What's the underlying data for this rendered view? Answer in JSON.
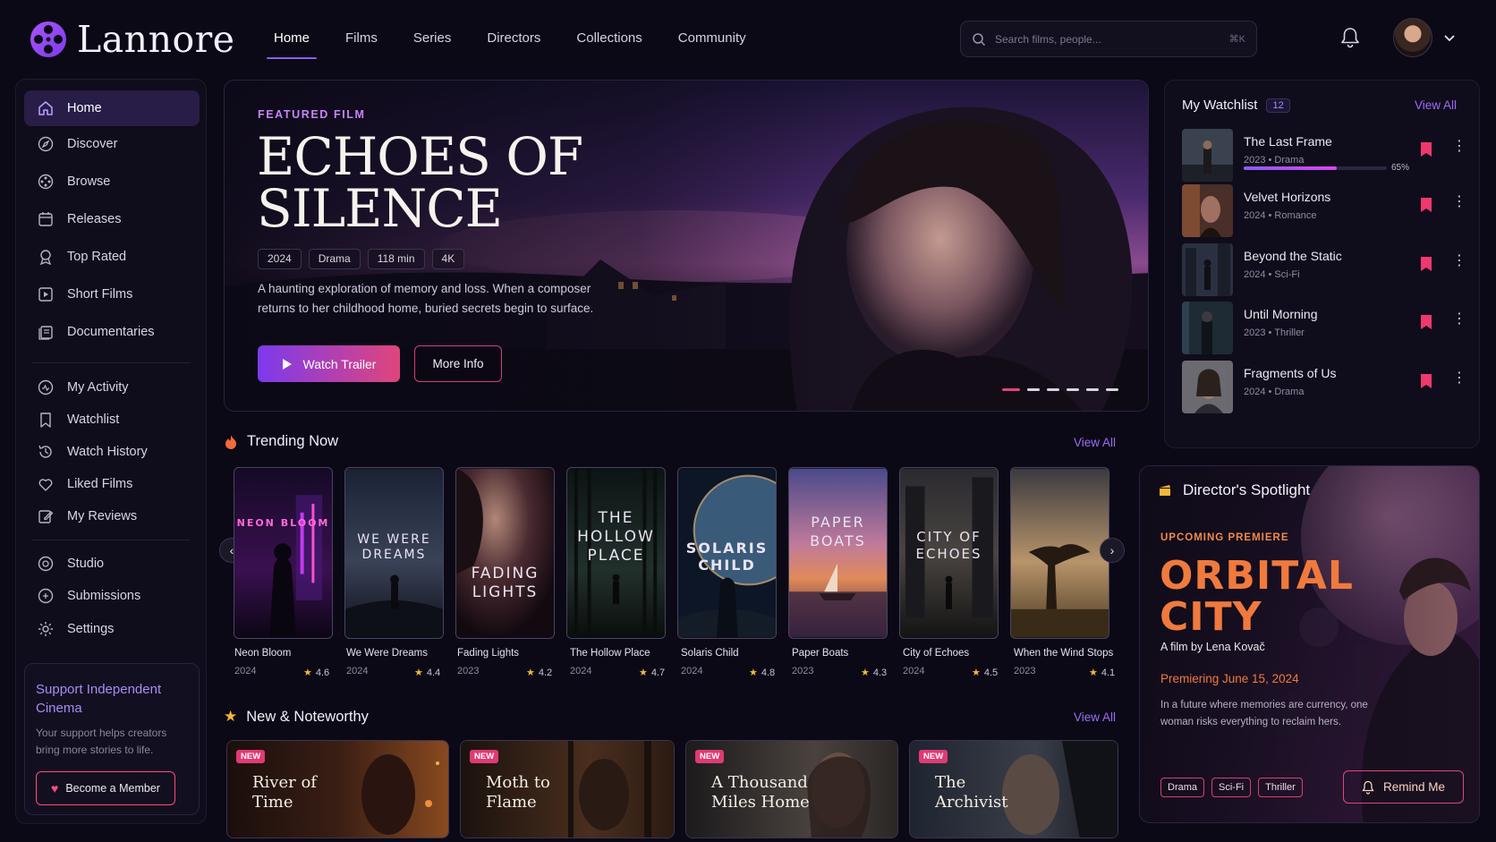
{
  "app": {
    "name": "Lannore"
  },
  "nav": {
    "items": [
      "Home",
      "Films",
      "Series",
      "Directors",
      "Collections",
      "Community"
    ],
    "active": "Home"
  },
  "search": {
    "placeholder": "Search films, people...",
    "shortcut": "⌘K"
  },
  "sidebar": {
    "primary": [
      {
        "label": "Home",
        "icon": "home-icon",
        "active": true
      },
      {
        "label": "Discover",
        "icon": "compass-icon"
      },
      {
        "label": "Browse",
        "icon": "film-reel-icon"
      },
      {
        "label": "Releases",
        "icon": "calendar-icon"
      },
      {
        "label": "Top Rated",
        "icon": "award-icon"
      },
      {
        "label": "Short Films",
        "icon": "short-film-icon"
      },
      {
        "label": "Documentaries",
        "icon": "documentary-icon"
      }
    ],
    "personal": [
      {
        "label": "My Activity",
        "icon": "activity-icon"
      },
      {
        "label": "Watchlist",
        "icon": "bookmark-icon"
      },
      {
        "label": "Watch History",
        "icon": "history-icon"
      },
      {
        "label": "Liked Films",
        "icon": "heart-icon"
      },
      {
        "label": "My Reviews",
        "icon": "edit-icon"
      }
    ],
    "tools": [
      {
        "label": "Studio",
        "icon": "studio-icon"
      },
      {
        "label": "Submissions",
        "icon": "submissions-icon"
      },
      {
        "label": "Settings",
        "icon": "gear-icon"
      }
    ],
    "support": {
      "title": "Support Independent Cinema",
      "text": "Your support helps creators bring more stories to life.",
      "button": "Become a Member"
    }
  },
  "hero": {
    "kicker": "FEATURED FILM",
    "title": "ECHOES OF SILENCE",
    "chips": [
      "2024",
      "Drama",
      "118 min",
      "4K"
    ],
    "description": "A haunting exploration of memory and loss. When a composer returns to her childhood home, buried secrets begin to surface.",
    "watch_trailer": "Watch Trailer",
    "more_info": "More Info",
    "slide_count": 6,
    "active_slide": 1
  },
  "trending": {
    "title": "Trending Now",
    "view_all": "View All",
    "items": [
      {
        "title": "Neon Bloom",
        "poster_text": "NEON BLOOM",
        "year": "2024",
        "rating": "4.6"
      },
      {
        "title": "We Were Dreams",
        "poster_text": "WE WERE DREAMS",
        "year": "2024",
        "rating": "4.4"
      },
      {
        "title": "Fading Lights",
        "poster_text": "FADING LIGHTS",
        "year": "2023",
        "rating": "4.2"
      },
      {
        "title": "The Hollow Place",
        "poster_text": "THE HOLLOW PLACE",
        "year": "2024",
        "rating": "4.7"
      },
      {
        "title": "Solaris Child",
        "poster_text": "SOLARIS CHILD",
        "year": "2024",
        "rating": "4.8"
      },
      {
        "title": "Paper Boats",
        "poster_text": "PAPER BOATS",
        "year": "2023",
        "rating": "4.3"
      },
      {
        "title": "City of Echoes",
        "poster_text": "CITY OF ECHOES",
        "year": "2024",
        "rating": "4.5"
      },
      {
        "title": "When the Wind Stops",
        "poster_text": "",
        "year": "2023",
        "rating": "4.1"
      }
    ]
  },
  "noteworthy": {
    "title": "New & Noteworthy",
    "view_all": "View All",
    "badge": "NEW",
    "items": [
      {
        "title": "River of Time"
      },
      {
        "title": "Moth to Flame"
      },
      {
        "title": "A Thousand Miles Home"
      },
      {
        "title": "The Archivist"
      }
    ]
  },
  "watchlist": {
    "title": "My Watchlist",
    "count": "12",
    "view_all": "View All",
    "items": [
      {
        "title": "The Last Frame",
        "meta": "2023 • Drama",
        "progress": 0.65,
        "progress_label": "65%"
      },
      {
        "title": "Velvet Horizons",
        "meta": "2024 • Romance"
      },
      {
        "title": "Beyond the Static",
        "meta": "2024 • Sci-Fi"
      },
      {
        "title": "Until Morning",
        "meta": "2023 • Thriller"
      },
      {
        "title": "Fragments of Us",
        "meta": "2024 • Drama"
      }
    ]
  },
  "spotlight": {
    "title": "Director's Spotlight",
    "kicker": "UPCOMING PREMIERE",
    "film_title": "ORBITAL CITY",
    "by": "A film by Lena Kovač",
    "premiere": "Premiering June 15, 2024",
    "description": "In a future where memories are currency, one woman risks everything to reclaim hers.",
    "tags": [
      "Drama",
      "Sci-Fi",
      "Thriller"
    ],
    "remind": "Remind Me"
  },
  "colors": {
    "accent": "#8b5cf6",
    "pink": "#e0457b",
    "orange": "#f07a3d",
    "bg": "#0b0916"
  }
}
